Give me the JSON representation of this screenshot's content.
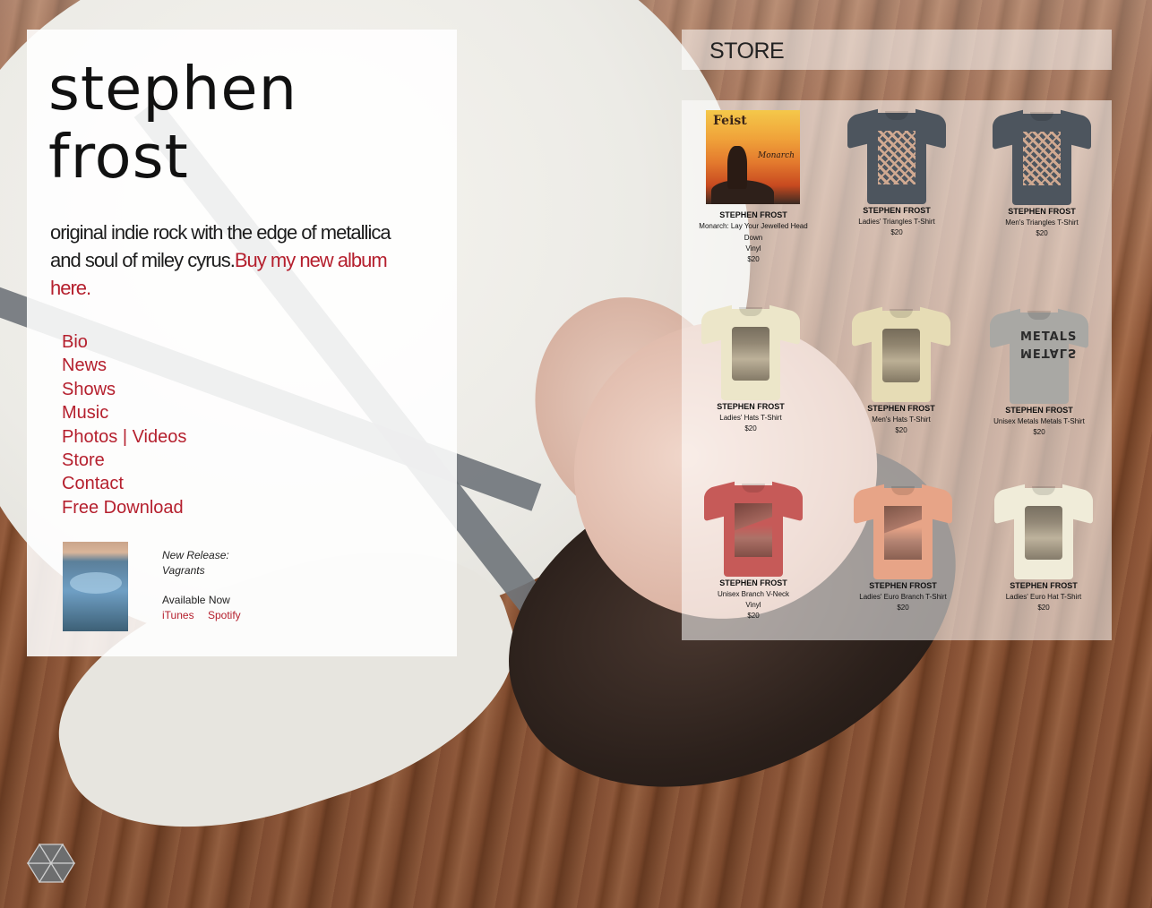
{
  "artist": {
    "name_line1": "stephen",
    "name_line2": "frost"
  },
  "tagline": {
    "text": "original indie rock with the edge of metallica and soul of miley cyrus.",
    "link": "Buy my new album here."
  },
  "nav": [
    {
      "label": "Bio"
    },
    {
      "label": "News"
    },
    {
      "label": "Shows"
    },
    {
      "label": "Music"
    },
    {
      "label": "Photos | Videos"
    },
    {
      "label": "Store"
    },
    {
      "label": "Contact"
    },
    {
      "label": "Free Download"
    }
  ],
  "release": {
    "heading": "New Release:",
    "title": "Vagrants",
    "availability": "Available Now",
    "links": [
      "iTunes",
      "Spotify"
    ]
  },
  "store": {
    "title": "STORE",
    "products": [
      {
        "brand": "STEPHEN FROST",
        "name": "Monarch: Lay Your Jewelled Head Down",
        "type": "Vinyl",
        "price": "$20",
        "cover_title": "Feist",
        "cover_sub": "Monarch",
        "image": "vinyl-cover"
      },
      {
        "brand": "STEPHEN FROST",
        "name": "Ladies' Triangles T-Shirt",
        "type": "",
        "price": "$20",
        "color": "#4d555e",
        "art": "triangles"
      },
      {
        "brand": "STEPHEN FROST",
        "name": "Men's Triangles T-Shirt",
        "type": "",
        "price": "$20",
        "color": "#4d555e",
        "art": "triangles"
      },
      {
        "brand": "STEPHEN FROST",
        "name": "Ladies' Hats T-Shirt",
        "type": "",
        "price": "$20",
        "color": "#ece6c9",
        "art": "hats"
      },
      {
        "brand": "STEPHEN FROST",
        "name": "Men's Hats T-Shirt",
        "type": "",
        "price": "$20",
        "color": "#e6dcb5",
        "art": "hats"
      },
      {
        "brand": "STEPHEN FROST",
        "name": "Unisex Metals Metals T-Shirt",
        "type": "",
        "price": "$20",
        "color": "#a9a8a4",
        "art": "metals",
        "art_text": "METALS"
      },
      {
        "brand": "STEPHEN FROST",
        "name": "Unisex Branch V-Neck",
        "type": "Vinyl",
        "price": "$20",
        "color": "#c65a58",
        "art": "branch"
      },
      {
        "brand": "STEPHEN FROST",
        "name": "Ladies' Euro Branch T-Shirt",
        "type": "",
        "price": "$20",
        "color": "#e7a487",
        "art": "branch"
      },
      {
        "brand": "STEPHEN FROST",
        "name": "Ladies' Euro Hat T-Shirt",
        "type": "",
        "price": "$20",
        "color": "#f0ecd9",
        "art": "hats"
      }
    ]
  },
  "colors": {
    "accent": "#b5202e",
    "text": "#111111"
  },
  "icons": {
    "site_logo": "hexagon-logo-icon"
  }
}
